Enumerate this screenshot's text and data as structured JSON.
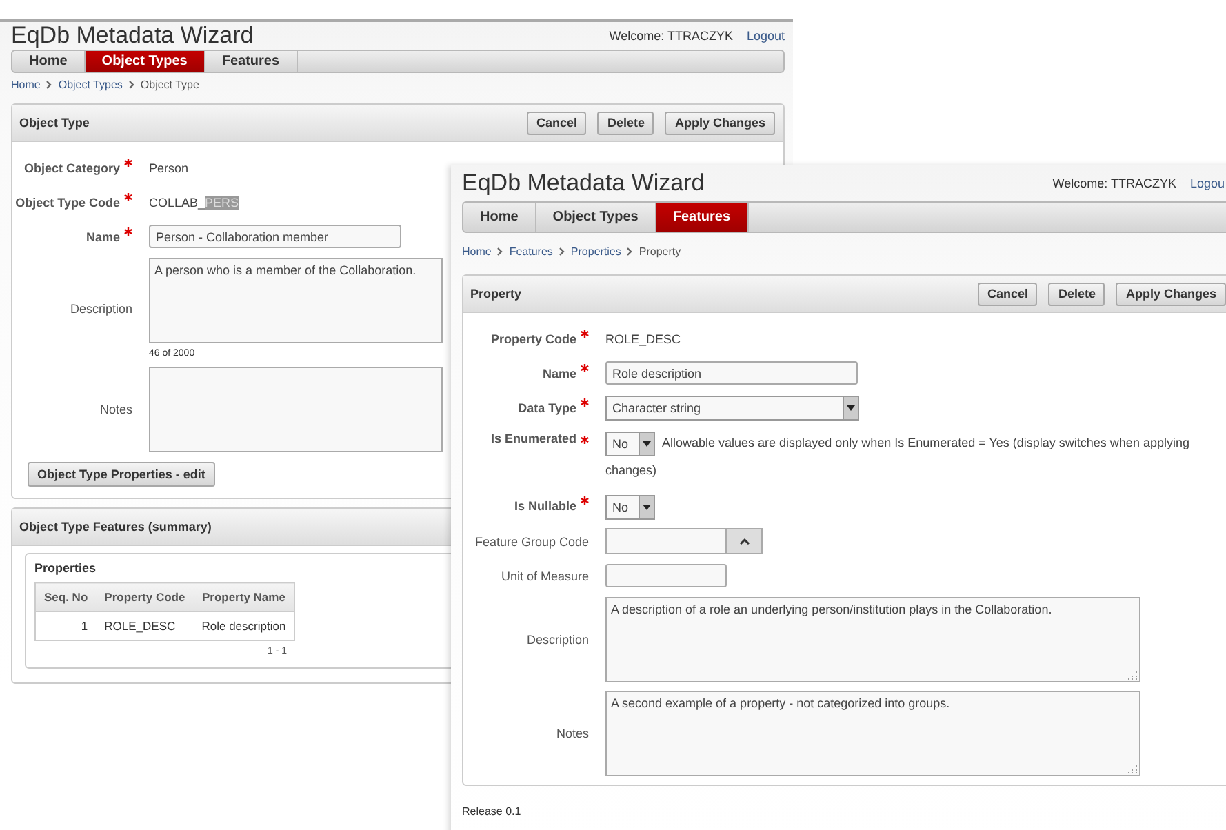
{
  "windows": [
    {
      "title": "EqDb Metadata Wizard",
      "welcome": "Welcome: TTRACZYK",
      "logout": "Logout",
      "tabs": [
        {
          "label": "Home",
          "selected": false
        },
        {
          "label": "Object Types",
          "selected": true
        },
        {
          "label": "Features",
          "selected": false
        }
      ],
      "breadcrumbs": [
        "Home",
        "Object Types",
        "Object Type"
      ],
      "region": {
        "title": "Object Type",
        "buttons": [
          "Cancel",
          "Delete",
          "Apply Changes"
        ]
      },
      "fields": [
        {
          "kind": "display",
          "label": "Object Category",
          "required": true,
          "parts": [
            {
              "text": "Person",
              "selected": false
            }
          ]
        },
        {
          "kind": "display",
          "label": "Object Type Code",
          "required": true,
          "parts": [
            {
              "text": "COLLAB_",
              "selected": false
            },
            {
              "text": "PERS",
              "selected": true
            }
          ]
        },
        {
          "kind": "text",
          "label": "Name",
          "required": true,
          "value": "Person - Collaboration member"
        },
        {
          "kind": "textarea",
          "label": "Description",
          "required": false,
          "value": "A person who is a member of the Collaboration.",
          "counter": "46 of 2000"
        },
        {
          "kind": "textarea",
          "label": "Notes",
          "required": false
        }
      ],
      "action": "Object Type Properties - edit",
      "summary": {
        "title": "Object Type Features (summary)",
        "subtitle": "Properties",
        "columns": [
          "Seq. No",
          "Property Code",
          "Property Name"
        ],
        "rows": [
          [
            "1",
            "ROLE_DESC",
            "Role description"
          ]
        ],
        "pagination": "1 - 1"
      }
    },
    {
      "title": "EqDb Metadata Wizard",
      "welcome": "Welcome: TTRACZYK",
      "logout": "Logou",
      "tabs": [
        {
          "label": "Home",
          "selected": false
        },
        {
          "label": "Object Types",
          "selected": false
        },
        {
          "label": "Features",
          "selected": true
        }
      ],
      "breadcrumbs": [
        "Home",
        "Features",
        "Properties",
        "Property"
      ],
      "region": {
        "title": "Property",
        "buttons": [
          "Cancel",
          "Delete",
          "Apply Changes"
        ]
      },
      "fields": [
        {
          "kind": "display",
          "label": "Property Code",
          "required": true,
          "parts": [
            {
              "text": "ROLE_DESC",
              "selected": false
            }
          ]
        },
        {
          "kind": "text",
          "label": "Name",
          "required": true,
          "value": "Role description"
        },
        {
          "kind": "select",
          "label": "Data Type",
          "required": true,
          "value": "Character string"
        },
        {
          "kind": "yes-no",
          "label": "Is Enumerated",
          "required": true,
          "value": "No",
          "help": "Allowable values are displayed only when Is Enumerated = Yes (display switches when applying changes)"
        },
        {
          "kind": "yes-no",
          "label": "Is Nullable",
          "required": true,
          "value": "No"
        },
        {
          "kind": "lov",
          "label": "Feature Group Code",
          "required": false
        },
        {
          "kind": "short-text",
          "label": "Unit of Measure",
          "required": false
        },
        {
          "kind": "textarea",
          "label": "Description",
          "required": false,
          "value": "A description of a role an underlying person/institution plays in the Collaboration.",
          "resizable": true
        },
        {
          "kind": "textarea",
          "label": "Notes",
          "required": false,
          "value": "A second example of a property - not categorized into groups.",
          "resizable": true
        }
      ],
      "footer": "Release 0.1"
    }
  ]
}
